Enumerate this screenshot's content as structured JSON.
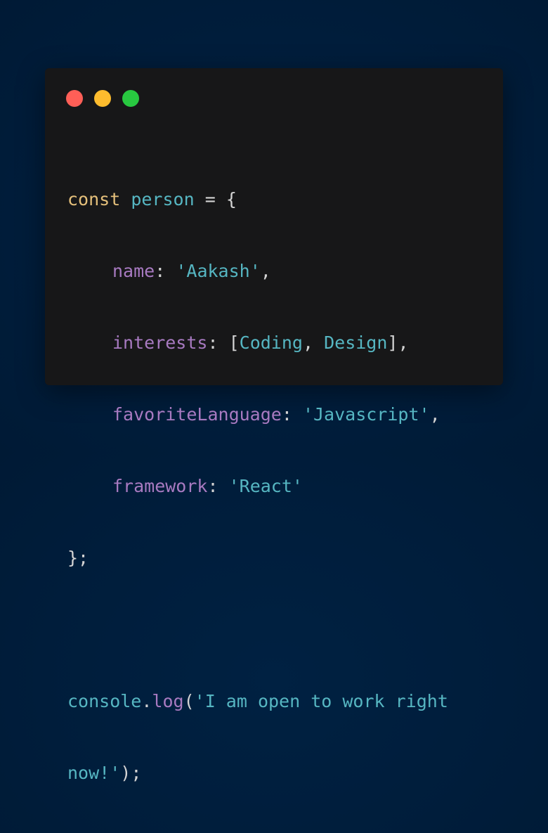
{
  "window": {
    "controls": {
      "close_color": "#ff5f57",
      "minimize_color": "#febc2e",
      "maximize_color": "#28c840"
    }
  },
  "code": {
    "line1": {
      "keyword": "const",
      "variable": "person",
      "operator": "=",
      "brace_open": "{"
    },
    "line2": {
      "prop": "name",
      "colon": ":",
      "value": "'Aakash'",
      "comma": ","
    },
    "line3": {
      "prop": "interests",
      "colon": ":",
      "bracket_open": "[",
      "item1": "Coding",
      "sep": ",",
      "item2": "Design",
      "bracket_close": "]",
      "comma": ","
    },
    "line4": {
      "prop": "favoriteLanguage",
      "colon": ":",
      "value": "'Javascript'",
      "comma": ","
    },
    "line5": {
      "prop": "framework",
      "colon": ":",
      "value": "'React'"
    },
    "line6": {
      "close": "};"
    },
    "line8": {
      "object": "console",
      "dot": ".",
      "method": "log",
      "paren_open": "(",
      "string_part1": "'I am open to work right"
    },
    "line9": {
      "string_part2": "now!'",
      "paren_close": ");"
    }
  }
}
